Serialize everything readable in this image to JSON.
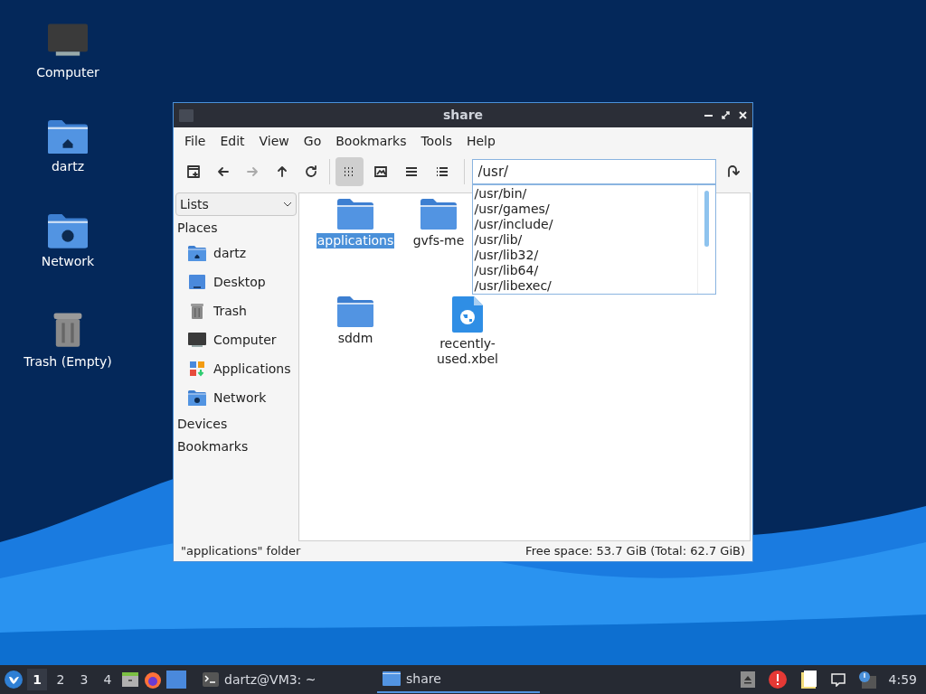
{
  "desktop": {
    "icons": [
      {
        "label": "Computer",
        "kind": "computer"
      },
      {
        "label": "dartz",
        "kind": "home"
      },
      {
        "label": "Network",
        "kind": "network"
      },
      {
        "label": "Trash (Empty)",
        "kind": "trash"
      }
    ]
  },
  "window": {
    "title": "share",
    "menu": [
      "File",
      "Edit",
      "View",
      "Go",
      "Bookmarks",
      "Tools",
      "Help"
    ],
    "view_modes": [
      {
        "kind": "icons",
        "selected": true
      },
      {
        "kind": "thumbnails",
        "selected": false
      },
      {
        "kind": "compact",
        "selected": false
      },
      {
        "kind": "detailed",
        "selected": false
      }
    ],
    "location": {
      "value": "/usr/"
    },
    "completions": [
      "/usr/bin/",
      "/usr/games/",
      "/usr/include/",
      "/usr/lib/",
      "/usr/lib32/",
      "/usr/lib64/",
      "/usr/libexec/"
    ],
    "sidebar": {
      "dropdown": "Lists",
      "sections": [
        {
          "title": "Places",
          "items": [
            {
              "label": "dartz",
              "kind": "home"
            },
            {
              "label": "Desktop",
              "kind": "desktop"
            },
            {
              "label": "Trash",
              "kind": "trash"
            },
            {
              "label": "Computer",
              "kind": "computer"
            },
            {
              "label": "Applications",
              "kind": "apps"
            },
            {
              "label": "Network",
              "kind": "network"
            }
          ]
        },
        {
          "title": "Devices"
        },
        {
          "title": "Bookmarks"
        }
      ]
    },
    "files": [
      {
        "name": "applications",
        "kind": "folder",
        "selected": true
      },
      {
        "name": "gvfs-me",
        "kind": "folder",
        "selected": false
      },
      {
        "name": "sddm",
        "kind": "folder",
        "selected": false
      },
      {
        "name": "recently-used.xbel",
        "kind": "web",
        "selected": false
      }
    ],
    "status_left": "\"applications\" folder",
    "status_right": "Free space: 53.7 GiB (Total: 62.7 GiB)"
  },
  "taskbar": {
    "workspaces": [
      {
        "label": "1",
        "selected": true
      },
      {
        "label": "2",
        "selected": false
      },
      {
        "label": "3",
        "selected": false
      },
      {
        "label": "4",
        "selected": false
      }
    ],
    "tasks": [
      {
        "label": "dartz@VM3: ~",
        "kind": "terminal",
        "selected": false
      },
      {
        "label": "share",
        "kind": "folder",
        "selected": true
      }
    ],
    "clock": "4:59"
  }
}
